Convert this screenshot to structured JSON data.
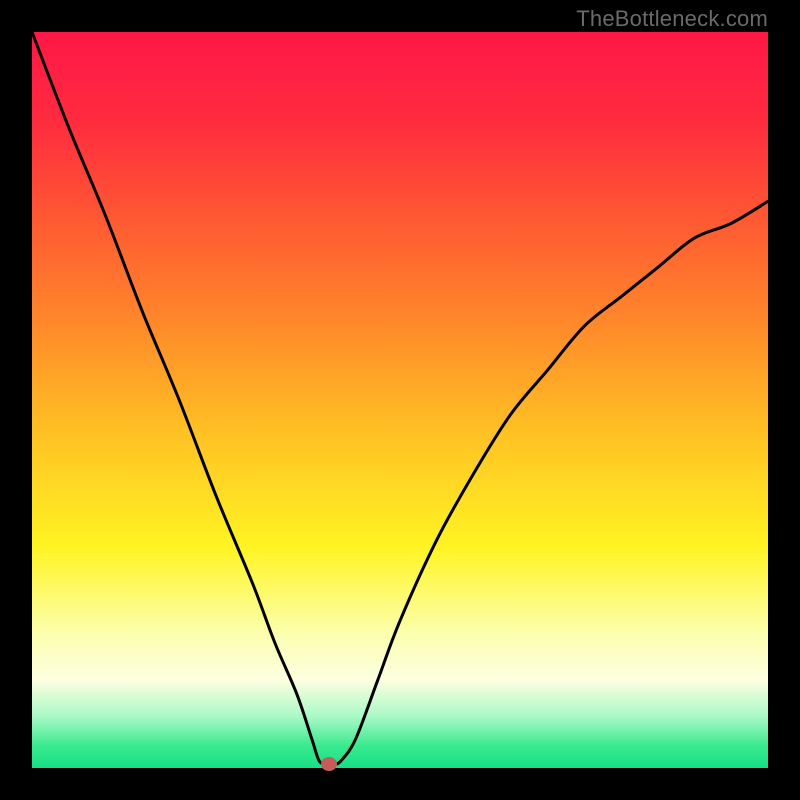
{
  "watermark": "TheBottleneck.com",
  "marker": {
    "color": "#c65c56",
    "x_fraction": 0.404,
    "y_fraction": 0.994
  },
  "gradient_stops": [
    {
      "offset": 0.0,
      "color": "#ff1846"
    },
    {
      "offset": 0.12,
      "color": "#ff2b3f"
    },
    {
      "offset": 0.25,
      "color": "#ff5733"
    },
    {
      "offset": 0.4,
      "color": "#ff8a2a"
    },
    {
      "offset": 0.55,
      "color": "#ffc324"
    },
    {
      "offset": 0.7,
      "color": "#fff423"
    },
    {
      "offset": 0.82,
      "color": "#fcffb0"
    },
    {
      "offset": 0.88,
      "color": "#fdffe0"
    },
    {
      "offset": 0.93,
      "color": "#aaf9c7"
    },
    {
      "offset": 0.97,
      "color": "#39e98f"
    },
    {
      "offset": 1.0,
      "color": "#17e084"
    }
  ],
  "chart_data": {
    "type": "line",
    "title": "",
    "xlabel": "",
    "ylabel": "",
    "xlim": [
      0,
      100
    ],
    "ylim": [
      0,
      100
    ],
    "legend": false,
    "grid": false,
    "annotations": [
      "TheBottleneck.com"
    ],
    "series": [
      {
        "name": "bottleneck-curve",
        "color": "#000000",
        "x": [
          0,
          5,
          10,
          15,
          20,
          25,
          30,
          33,
          36,
          38,
          39,
          40,
          41,
          42,
          44,
          47,
          50,
          55,
          60,
          65,
          70,
          75,
          80,
          85,
          90,
          95,
          100
        ],
        "y": [
          100,
          87,
          75,
          62,
          50,
          37,
          25,
          17,
          10,
          4,
          1,
          0.5,
          0.5,
          1,
          4,
          12,
          20,
          31,
          40,
          48,
          54,
          60,
          64,
          68,
          72,
          74,
          77
        ]
      }
    ],
    "marker_point": {
      "x": 40.4,
      "y": 0.6,
      "color": "#c65c56"
    }
  }
}
